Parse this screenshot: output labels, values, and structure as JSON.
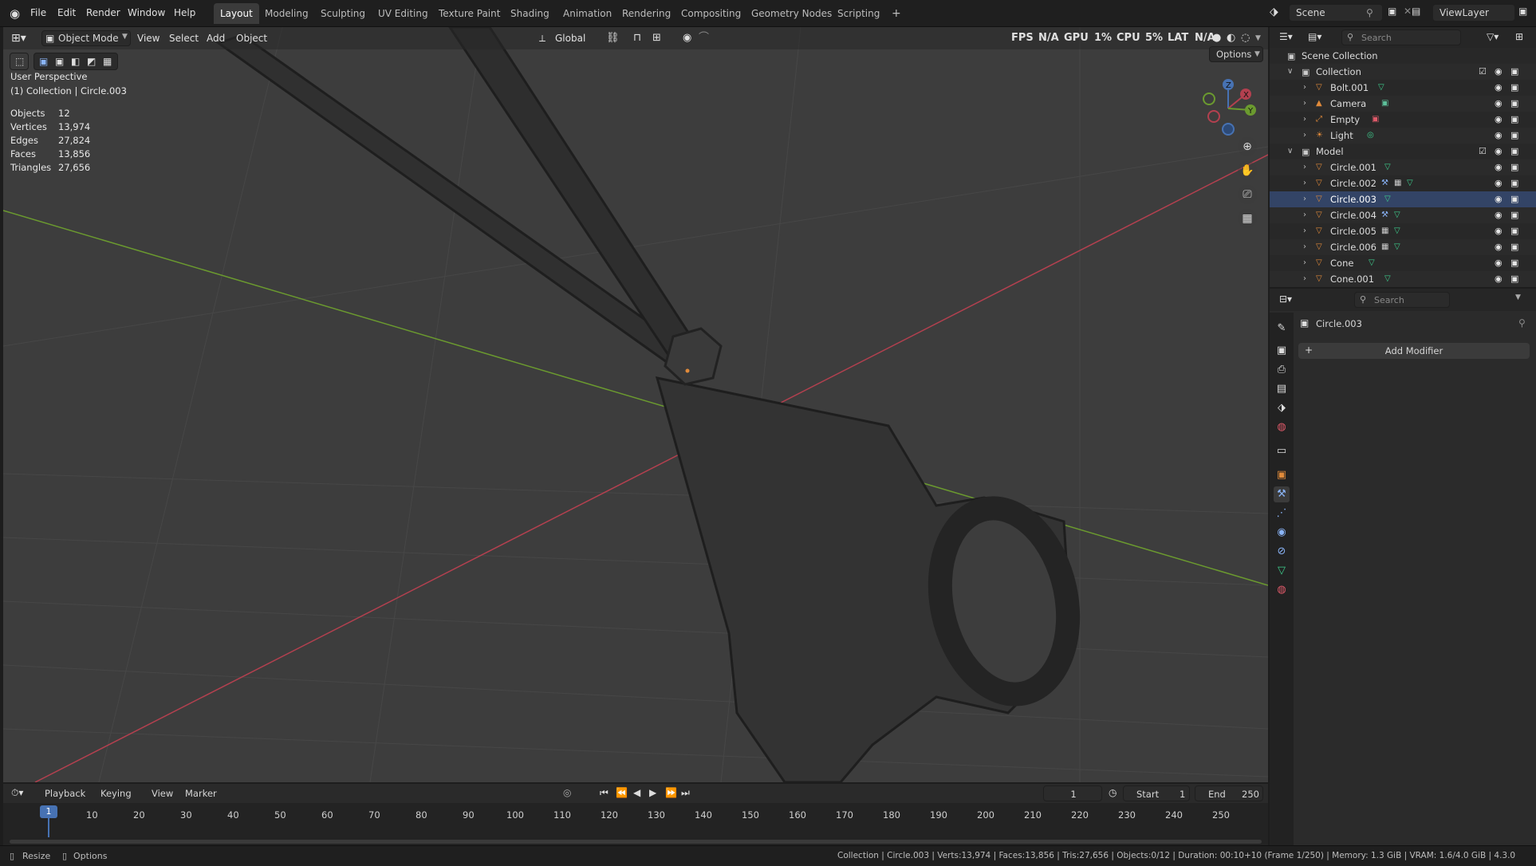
{
  "topbar": {
    "menus": [
      "File",
      "Edit",
      "Render",
      "Window",
      "Help"
    ],
    "workspaces": [
      "Layout",
      "Modeling",
      "Sculpting",
      "UV Editing",
      "Texture Paint",
      "Shading",
      "Animation",
      "Rendering",
      "Compositing",
      "Geometry Nodes",
      "Scripting"
    ],
    "active_workspace": "Layout",
    "add_tab": "+",
    "scene_label": "Scene",
    "view_layer_label": "ViewLayer"
  },
  "viewport_header": {
    "mode": "Object Mode",
    "menus": [
      "View",
      "Select",
      "Add",
      "Object"
    ],
    "orientation": "Global",
    "options_label": "Options",
    "fps_label": "FPS",
    "fps_value": "N/A",
    "gpu_label": "GPU",
    "gpu_value": "1%",
    "cpu_label": "CPU",
    "cpu_value": "5%",
    "lat_label": "LAT",
    "lat_value": "N/A"
  },
  "viewport_info": {
    "perspective": "User Perspective",
    "context": "(1) Collection | Circle.003",
    "stats": [
      {
        "label": "Objects",
        "value": "12"
      },
      {
        "label": "Vertices",
        "value": "13,974"
      },
      {
        "label": "Edges",
        "value": "27,824"
      },
      {
        "label": "Faces",
        "value": "13,856"
      },
      {
        "label": "Triangles",
        "value": "27,656"
      }
    ],
    "gizmo_axes": {
      "x": "X",
      "y": "Y",
      "z": "Z"
    }
  },
  "outliner": {
    "search_placeholder": "Search",
    "root": "Scene Collection",
    "collections": [
      {
        "name": "Collection",
        "items": [
          "Bolt.001",
          "Camera",
          "Empty",
          "Light"
        ]
      },
      {
        "name": "Model",
        "items": [
          "Circle.001",
          "Circle.002",
          "Circle.003",
          "Circle.004",
          "Circle.005",
          "Circle.006",
          "Cone",
          "Cone.001"
        ]
      }
    ],
    "selected": "Circle.003"
  },
  "properties": {
    "search_placeholder": "Search",
    "object_name": "Circle.003",
    "add_modifier_label": "Add Modifier"
  },
  "timeline": {
    "menus": [
      "Playback",
      "Keying",
      "View",
      "Marker"
    ],
    "current_frame": "1",
    "start_label": "Start",
    "start_value": "1",
    "end_label": "End",
    "end_value": "250",
    "playhead": "1",
    "ticks": [
      "10",
      "20",
      "30",
      "40",
      "50",
      "60",
      "70",
      "80",
      "90",
      "100",
      "110",
      "120",
      "130",
      "140",
      "150",
      "160",
      "170",
      "180",
      "190",
      "200",
      "210",
      "220",
      "230",
      "240",
      "250"
    ]
  },
  "statusbar": {
    "left1": "Resize",
    "left2": "Options",
    "right": "Collection | Circle.003 | Verts:13,974 | Faces:13,856 | Tris:27,656 | Objects:0/12 | Duration: 00:10+10 (Frame 1/250) | Memory: 1.3 GiB | VRAM: 1.6/4.0 GiB | 4.3.0"
  },
  "colors": {
    "x_axis": "#b3404f",
    "y_axis": "#6b9a2f",
    "accent": "#4772b3",
    "mesh_orange": "#e08a3a"
  }
}
